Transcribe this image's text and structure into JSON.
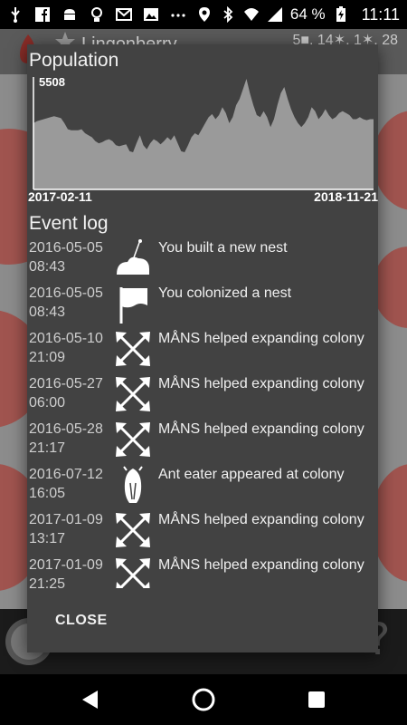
{
  "statusbar": {
    "battery": "64 %",
    "time": "11:11",
    "icons": [
      "usb-icon",
      "facebook-icon",
      "android-icon",
      "bulb-icon",
      "gmail-icon",
      "image-icon",
      "more-icon",
      "location-icon",
      "bluetooth-icon",
      "wifi-icon",
      "signal-icon",
      "battery-charging-icon"
    ]
  },
  "background": {
    "title": "Lingonberry",
    "stats": "5■, 14✶, 1✶, 28"
  },
  "dialog": {
    "population_title": "Population",
    "close_label": "CLOSE",
    "event_log_title": "Event log",
    "events": [
      {
        "date": "2016-05-05",
        "time": "08:43",
        "icon": "nest-icon",
        "text": "You built a new nest"
      },
      {
        "date": "2016-05-05",
        "time": "08:43",
        "icon": "flag-icon",
        "text": "You colonized a nest"
      },
      {
        "date": "2016-05-10",
        "time": "21:09",
        "icon": "expand-arrows-icon",
        "text": "MÅNS helped expanding colony"
      },
      {
        "date": "2016-05-27",
        "time": "06:00",
        "icon": "expand-arrows-icon",
        "text": "MÅNS helped expanding colony"
      },
      {
        "date": "2016-05-28",
        "time": "21:17",
        "icon": "expand-arrows-icon",
        "text": "MÅNS helped expanding colony"
      },
      {
        "date": "2016-07-12",
        "time": "16:05",
        "icon": "anteater-icon",
        "text": "Ant eater appeared at colony"
      },
      {
        "date": "2017-01-09",
        "time": "13:17",
        "icon": "expand-arrows-icon",
        "text": "MÅNS helped expanding colony"
      },
      {
        "date": "2017-01-09",
        "time": "21:25",
        "icon": "expand-arrows-icon",
        "text": "MÅNS helped expanding colony"
      }
    ]
  },
  "chart_data": {
    "type": "area",
    "title": "Population",
    "x_start": "2017-02-11",
    "x_end": "2018-11-21",
    "max_label": "5508",
    "ylim": [
      0,
      5508
    ],
    "values": [
      3300,
      3400,
      3450,
      3500,
      3550,
      3600,
      3650,
      3600,
      3550,
      3300,
      3000,
      2950,
      2950,
      2950,
      3000,
      2800,
      2700,
      2600,
      2400,
      2300,
      2350,
      2450,
      2500,
      2400,
      2200,
      2150,
      2200,
      2250,
      1900,
      1850,
      2300,
      2700,
      2200,
      2000,
      2300,
      2500,
      2400,
      2250,
      2400,
      2600,
      2450,
      2700,
      2300,
      1900,
      1850,
      2200,
      2600,
      2800,
      2700,
      3000,
      3300,
      3600,
      3750,
      3500,
      3700,
      4100,
      3800,
      3300,
      3600,
      4200,
      4500,
      5000,
      5508,
      4800,
      4200,
      3700,
      3600,
      3900,
      3600,
      3100,
      3500,
      4200,
      4800,
      5100,
      4500,
      4000,
      3600,
      3300,
      3100,
      3300,
      3600,
      4100,
      3900,
      3500,
      3700,
      4000,
      3700,
      3500,
      3600,
      3800,
      3900,
      3800,
      3700,
      3500,
      3500,
      3600,
      3500,
      3450,
      3500,
      3500
    ],
    "color": "#9a9a9a"
  },
  "colors": {
    "dialog_bg": "#424242",
    "chart_fill": "#9a9a9a",
    "chart_bg": "#424242",
    "nest_red": "#a34a44"
  },
  "navbar": {
    "icons": [
      "back-icon",
      "home-icon",
      "recents-icon"
    ]
  }
}
